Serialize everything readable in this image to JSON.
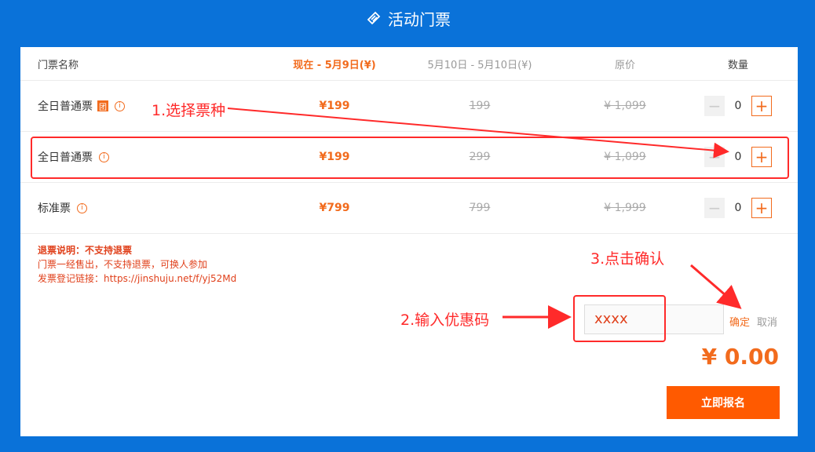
{
  "header": {
    "title": "活动门票",
    "icon": "ticket-icon"
  },
  "table": {
    "headers": {
      "name": "门票名称",
      "now": "现在 - 5月9日(¥)",
      "later": "5月10日 - 5月10日(¥)",
      "original": "原价",
      "quantity": "数量"
    },
    "rows": [
      {
        "name": "全日普通票",
        "badge": "团",
        "now_price": "¥199",
        "later_price": "199",
        "original_price": "¥ 1,099",
        "quantity": "0"
      },
      {
        "name": "全日普通票",
        "now_price": "¥199",
        "later_price": "299",
        "original_price": "¥ 1,099",
        "quantity": "0"
      },
      {
        "name": "标准票",
        "now_price": "¥799",
        "later_price": "799",
        "original_price": "¥ 1,999",
        "quantity": "0"
      }
    ],
    "minus_label": "−",
    "plus_label": "+"
  },
  "notes": {
    "title": "退票说明：不支持退票",
    "line1": "门票一经售出，不支持退票，可换人参加",
    "line2": "发票登记链接：https://jinshuju.net/f/yj52Md"
  },
  "coupon": {
    "value": "xxxx",
    "confirm_label": "确定",
    "cancel_label": "取消"
  },
  "total": "¥ 0.00",
  "register_label": "立即报名",
  "annotations": {
    "step1": "1.选择票种",
    "step2": "2.输入优惠码",
    "step3": "3.点击确认"
  },
  "colors": {
    "brand_blue": "#0a72d9",
    "accent_orange": "#f26b1d",
    "annotation_red": "#ff2a2a"
  }
}
